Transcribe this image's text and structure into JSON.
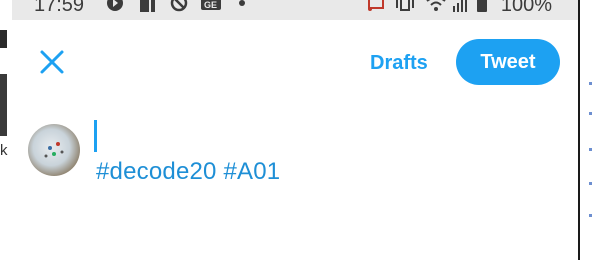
{
  "status_bar": {
    "time": "17:59",
    "battery_percent": "100%",
    "icons": [
      "youtube-icon",
      "sim-icon",
      "blocked-icon",
      "ge-icon",
      "dot-icon",
      "cast-icon",
      "vibrate-icon",
      "wifi-icon",
      "signal-icon",
      "battery-icon"
    ]
  },
  "compose": {
    "drafts_label": "Drafts",
    "tweet_label": "Tweet",
    "text": "#decode20 #A01"
  },
  "background": {
    "left_char": "k"
  },
  "colors": {
    "accent": "#1da1f2",
    "hashtag": "#1e8fd6",
    "status_bg": "#e9e9e9"
  }
}
